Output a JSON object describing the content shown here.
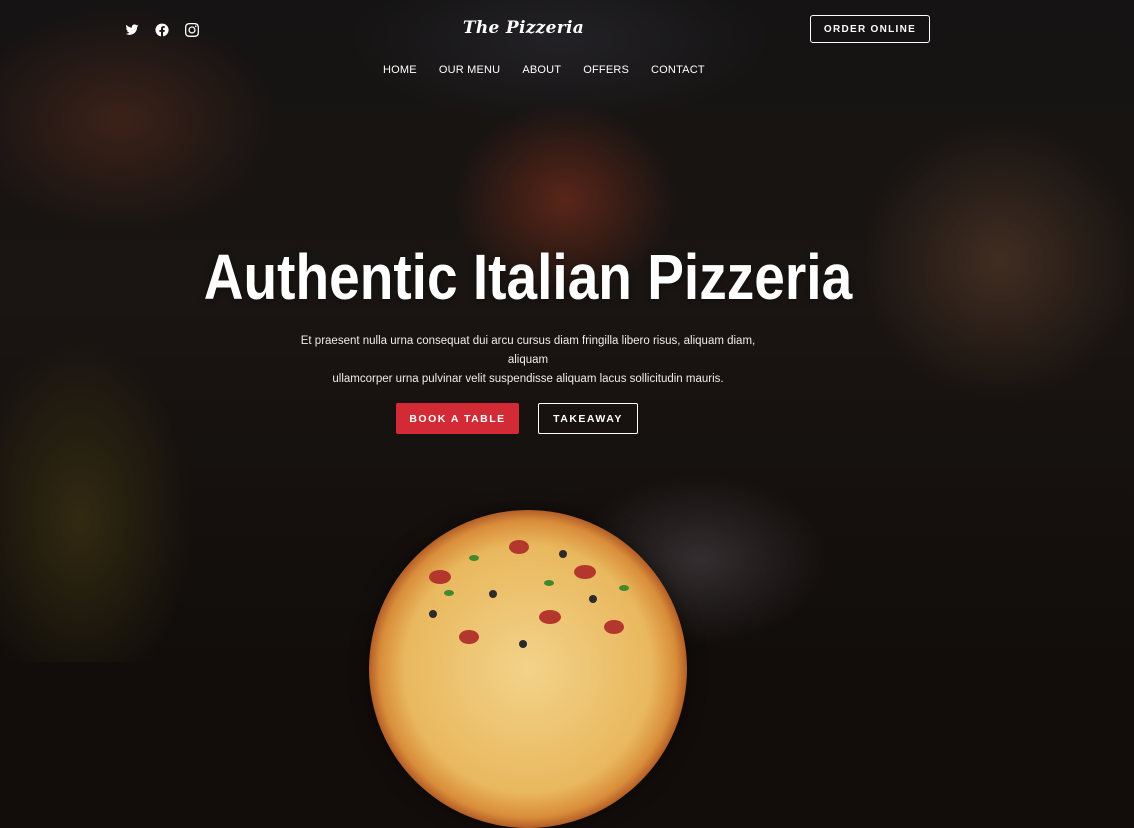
{
  "header": {
    "social": [
      {
        "name": "twitter-icon"
      },
      {
        "name": "facebook-icon"
      },
      {
        "name": "instagram-icon"
      }
    ],
    "logo": "The Pizzeria",
    "order_button": "ORDER ONLINE"
  },
  "nav": {
    "items": [
      "HOME",
      "OUR MENU",
      "ABOUT",
      "OFFERS",
      "CONTACT"
    ]
  },
  "hero": {
    "title": "Authentic Italian Pizzeria",
    "subtitle_line1": "Et praesent nulla urna consequat dui arcu cursus diam fringilla libero risus, aliquam diam, aliquam",
    "subtitle_line2": "ullamcorper urna pulvinar velit suspendisse aliquam lacus sollicitudin mauris.",
    "primary_button": "BOOK A TABLE",
    "secondary_button": "TAKEAWAY"
  },
  "colors": {
    "accent": "#d32b36",
    "text": "#ffffff"
  }
}
